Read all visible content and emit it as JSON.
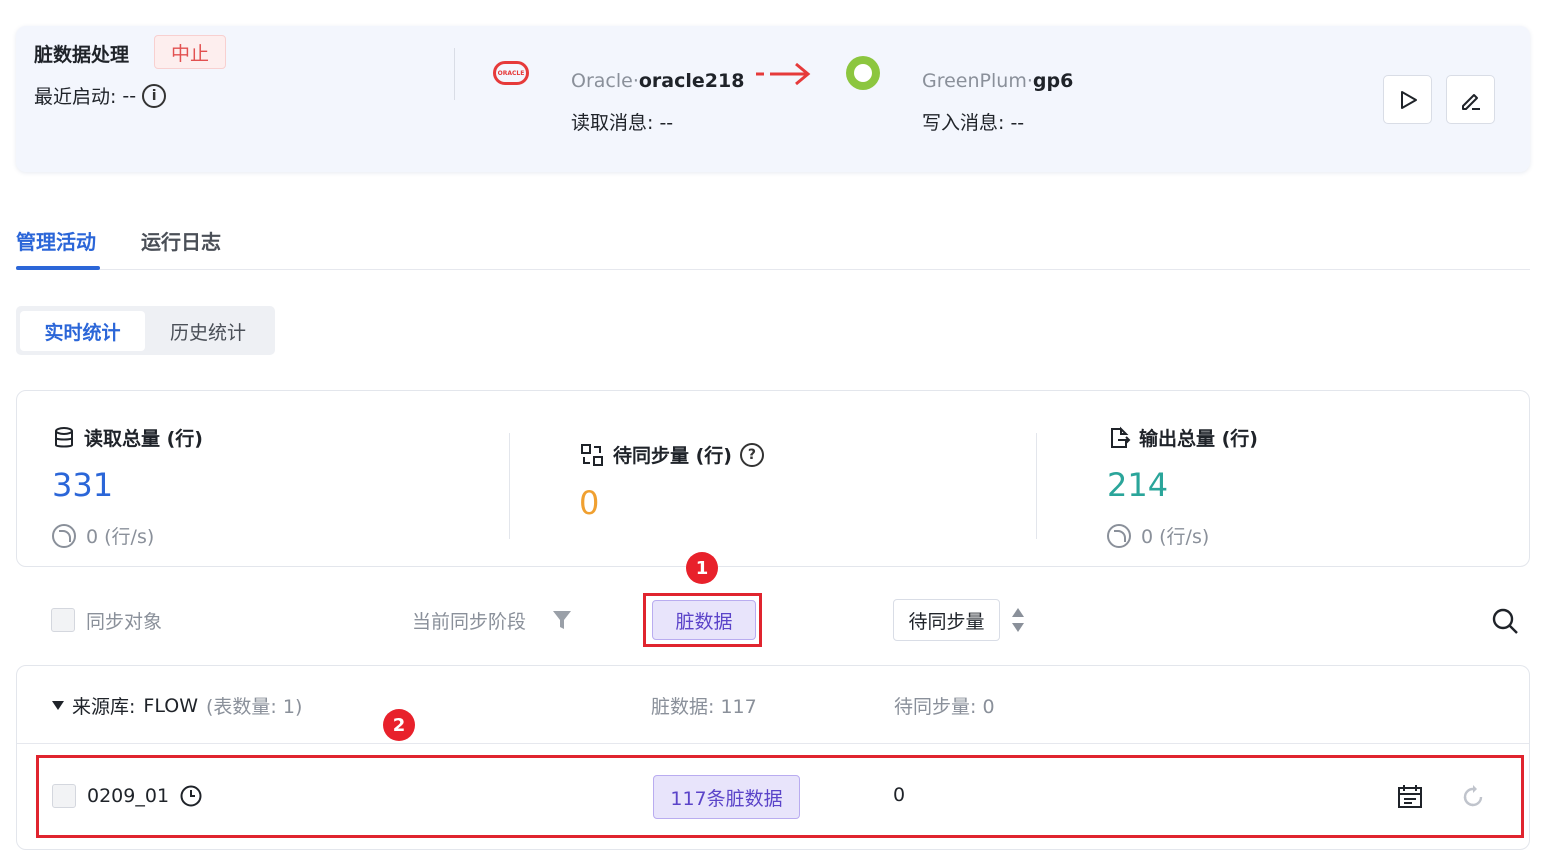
{
  "task": {
    "name": "脏数据处理",
    "status": "中止",
    "recent_start_label": "最近启动:",
    "recent_start_value": "--"
  },
  "source": {
    "type": "Oracle",
    "separator": "·",
    "name": "oracle218",
    "read_label": "读取消息:",
    "read_value": "--",
    "logo_text": "ORACLE"
  },
  "target": {
    "type": "GreenPlum",
    "separator": "·",
    "name": "gp6",
    "write_label": "写入消息:",
    "write_value": "--"
  },
  "tabs": [
    {
      "label": "管理活动",
      "active": true
    },
    {
      "label": "运行日志",
      "active": false
    }
  ],
  "segments": [
    {
      "label": "实时统计",
      "active": true
    },
    {
      "label": "历史统计",
      "active": false
    }
  ],
  "stats": {
    "read": {
      "title": "读取总量 (行)",
      "value": "331",
      "rate": "0 (行/s)",
      "color": "#2b66d8"
    },
    "pending": {
      "title": "待同步量 (行)",
      "value": "0",
      "color": "#f0a030"
    },
    "output": {
      "title": "输出总量 (行)",
      "value": "214",
      "rate": "0 (行/s)",
      "color": "#2aa59a"
    }
  },
  "annotations": {
    "badge1": "1",
    "badge2": "2"
  },
  "filter_row": {
    "sync_object": "同步对象",
    "current_stage": "当前同步阶段",
    "dirty_data": "脏数据",
    "pending_amount": "待同步量"
  },
  "group": {
    "prefix": "来源库:",
    "db_name": "FLOW",
    "table_count": "(表数量: 1)",
    "dirty_label": "脏数据:",
    "dirty_value": "117",
    "pending_label": "待同步量:",
    "pending_value": "0"
  },
  "rows": [
    {
      "name": "0209_01",
      "dirty": "117条脏数据",
      "pending": "0"
    }
  ],
  "colors": {
    "accent": "#2b66d8",
    "danger": "#e25050",
    "annotation_red": "#e0242e",
    "purple": "#5b44c9"
  }
}
